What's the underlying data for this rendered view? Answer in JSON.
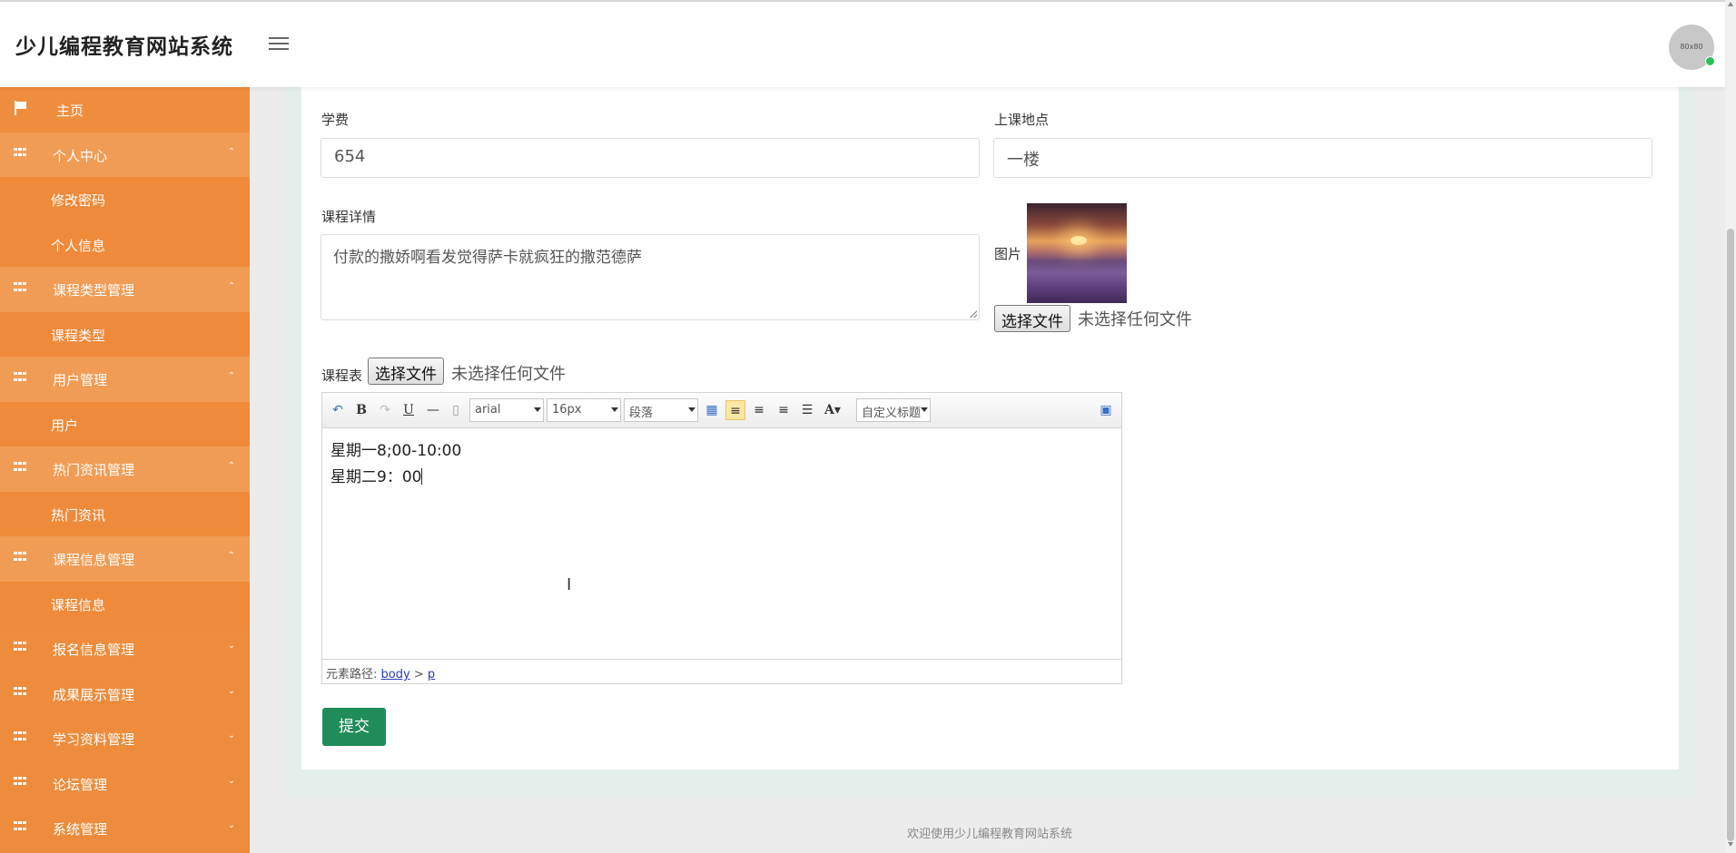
{
  "header": {
    "title": "少儿编程教育网站系统",
    "avatar_text": "80x80"
  },
  "sidebar": {
    "items": [
      {
        "label": "主页",
        "kind": "top",
        "icon": "flag-icon"
      },
      {
        "label": "个人中心",
        "kind": "group",
        "open": true,
        "icon": "grid-icon"
      },
      {
        "label": "修改密码",
        "kind": "sub"
      },
      {
        "label": "个人信息",
        "kind": "sub"
      },
      {
        "label": "课程类型管理",
        "kind": "group",
        "open": true,
        "icon": "grid-icon"
      },
      {
        "label": "课程类型",
        "kind": "sub"
      },
      {
        "label": "用户管理",
        "kind": "group",
        "open": true,
        "icon": "grid-icon"
      },
      {
        "label": "用户",
        "kind": "sub"
      },
      {
        "label": "热门资讯管理",
        "kind": "group",
        "open": true,
        "icon": "grid-icon"
      },
      {
        "label": "热门资讯",
        "kind": "sub"
      },
      {
        "label": "课程信息管理",
        "kind": "group",
        "open": true,
        "icon": "grid-icon"
      },
      {
        "label": "课程信息",
        "kind": "sub"
      },
      {
        "label": "报名信息管理",
        "kind": "group",
        "open": false,
        "icon": "grid-icon"
      },
      {
        "label": "成果展示管理",
        "kind": "group",
        "open": false,
        "icon": "grid-icon"
      },
      {
        "label": "学习资料管理",
        "kind": "group",
        "open": false,
        "icon": "grid-icon"
      },
      {
        "label": "论坛管理",
        "kind": "group",
        "open": false,
        "icon": "grid-icon"
      },
      {
        "label": "系统管理",
        "kind": "group",
        "open": false,
        "icon": "grid-icon"
      }
    ]
  },
  "form": {
    "fee_label": "学费",
    "fee_value": "654",
    "location_label": "上课地点",
    "location_value": "一楼",
    "details_label": "课程详情",
    "details_value": "付款的撒娇啊看发觉得萨卡就疯狂的撒范德萨",
    "image_label": "图片",
    "image_file_button": "选择文件",
    "image_file_status": "未选择任何文件",
    "schedule_label": "课程表",
    "schedule_file_button": "选择文件",
    "schedule_file_status": "未选择任何文件",
    "submit_label": "提交"
  },
  "editor": {
    "font_family": "arial",
    "font_size": "16px",
    "paragraph": "段落",
    "custom_heading": "自定义标题",
    "content_lines": [
      "星期一8;00-10:00",
      "星期二9：00"
    ],
    "path_label": "元素路径:",
    "path_body": "body",
    "path_sep": ">",
    "path_p": "p"
  },
  "footer": {
    "text": "欢迎使用少儿编程教育网站系统"
  },
  "colors": {
    "sidebar": "#ee8a3a",
    "sidebar_open_group": "#f19c55",
    "submit": "#1f8c59",
    "panel_bg": "#e4efeb"
  }
}
